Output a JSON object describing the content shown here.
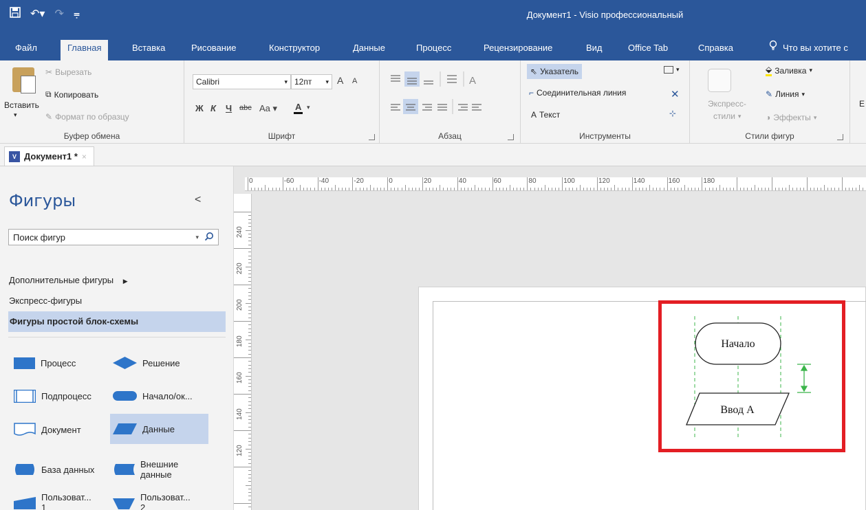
{
  "titlebar": {
    "title": "Документ1  -  Visio профессиональный",
    "save_icon": "save-icon",
    "undo_icon": "undo-icon",
    "redo_icon": "redo-icon",
    "customize_icon": "customize-qat-icon"
  },
  "tabs": [
    {
      "label": "Файл"
    },
    {
      "label": "Главная"
    },
    {
      "label": "Вставка"
    },
    {
      "label": "Рисование"
    },
    {
      "label": "Конструктор"
    },
    {
      "label": "Данные"
    },
    {
      "label": "Процесс"
    },
    {
      "label": "Рецензирование"
    },
    {
      "label": "Вид"
    },
    {
      "label": "Office Tab"
    },
    {
      "label": "Справка"
    },
    {
      "label": "Что вы хотите с"
    }
  ],
  "ribbon": {
    "clipboard": {
      "paste": "Вставить",
      "cut": "Вырезать",
      "copy": "Копировать",
      "format_painter": "Формат по образцу",
      "label": "Буфер обмена"
    },
    "font": {
      "name": "Calibri",
      "size": "12пт",
      "grow": "A",
      "shrink": "A",
      "bold": "Ж",
      "italic": "К",
      "underline": "Ч",
      "strike": "abc",
      "case": "Aa",
      "color": "A",
      "label": "Шрифт"
    },
    "paragraph": {
      "label": "Абзац"
    },
    "tools": {
      "pointer": "Указатель",
      "connector": "Соединительная линия",
      "text": "Текст",
      "label": "Инструменты"
    },
    "shape_styles": {
      "express": "Экспресс-",
      "styles": "стили",
      "fill": "Заливка",
      "line": "Линия",
      "effects": "Эффекты",
      "label": "Стили фигур"
    },
    "cut_glyph": "E"
  },
  "document_tab": {
    "label": "Документ1 *",
    "close": "×"
  },
  "shapes_pane": {
    "title": "Фигуры",
    "collapse": "<",
    "search_placeholder": "Поиск фигур",
    "stencils": [
      {
        "label": "Дополнительные фигуры"
      },
      {
        "label": "Экспресс-фигуры"
      },
      {
        "label": "Фигуры простой блок-схемы"
      }
    ],
    "shapes": [
      {
        "label": "Процесс"
      },
      {
        "label": "Решение"
      },
      {
        "label": "Подпроцесс"
      },
      {
        "label": "Начало/ок..."
      },
      {
        "label": "Документ"
      },
      {
        "label": "Данные"
      },
      {
        "label": "База данных"
      },
      {
        "label": "Внешние данные"
      },
      {
        "label": "Пользоват... 1"
      },
      {
        "label": "Пользоват... 2"
      }
    ]
  },
  "ruler": {
    "h_labels": [
      "0",
      "-60",
      "-40",
      "-20",
      "0",
      "20",
      "40",
      "60",
      "80",
      "100",
      "120",
      "140",
      "160",
      "180"
    ],
    "v_labels": [
      "240",
      "220",
      "200",
      "180",
      "160",
      "140",
      "120"
    ]
  },
  "diagram": {
    "start_label": "Начало",
    "input_label": "Ввод А"
  },
  "colors": {
    "brand": "#2b579a",
    "highlight": "#e31e24",
    "shape_fill": "#2e75c9",
    "guide": "#3bb54a"
  }
}
